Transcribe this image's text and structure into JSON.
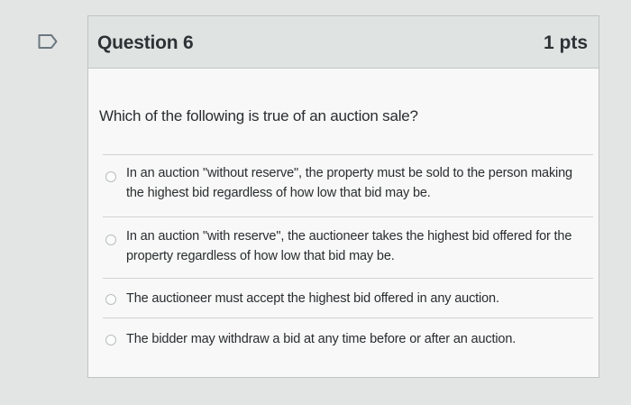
{
  "question": {
    "title": "Question 6",
    "points": "1 pts",
    "text": "Which of the following is true of an auction sale?"
  },
  "answers": [
    {
      "text": "In an auction \"without reserve\", the property must be sold to the person making the highest bid regardless of how low that bid may be.",
      "selected": false
    },
    {
      "text": "In an auction \"with reserve\", the auctioneer takes the highest bid offered for the property regardless of how low that bid may be.",
      "selected": false
    },
    {
      "text": "The auctioneer must accept the highest bid offered in any auction.",
      "selected": false
    },
    {
      "text": "The bidder may withdraw a bid at any time before or after an auction.",
      "selected": false
    }
  ],
  "colors": {
    "background": "#e3e5e4",
    "card": "#f7f8f7",
    "header": "#dfe3e2",
    "flag": "#6b7780"
  },
  "icons": {
    "flag": "flag-question-icon",
    "radio": "radio-unchecked-icon"
  }
}
